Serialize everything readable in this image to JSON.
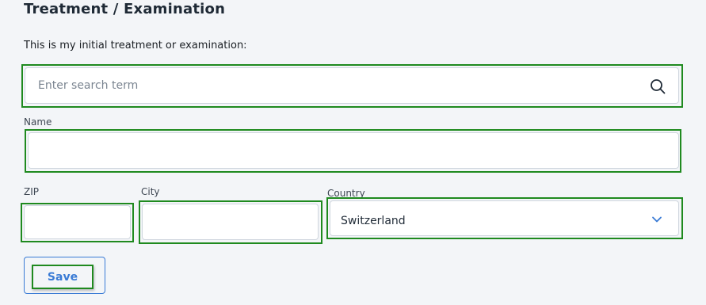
{
  "section": {
    "title": "Treatment / Examination",
    "subtitle": "This is my initial treatment or examination:"
  },
  "search": {
    "placeholder": "Enter search term",
    "value": ""
  },
  "form": {
    "name_label": "Name",
    "name_value": "",
    "zip_label": "ZIP",
    "zip_value": "",
    "city_label": "City",
    "city_value": "",
    "country_label": "Country",
    "country_value": "Switzerland"
  },
  "actions": {
    "save_label": "Save"
  },
  "icons": {
    "search": "search-icon",
    "dropdown": "chevron-down-icon"
  },
  "colors": {
    "accent": "#3a7bd5",
    "highlight": "#1f8a1f",
    "background": "#f3f5f8"
  }
}
